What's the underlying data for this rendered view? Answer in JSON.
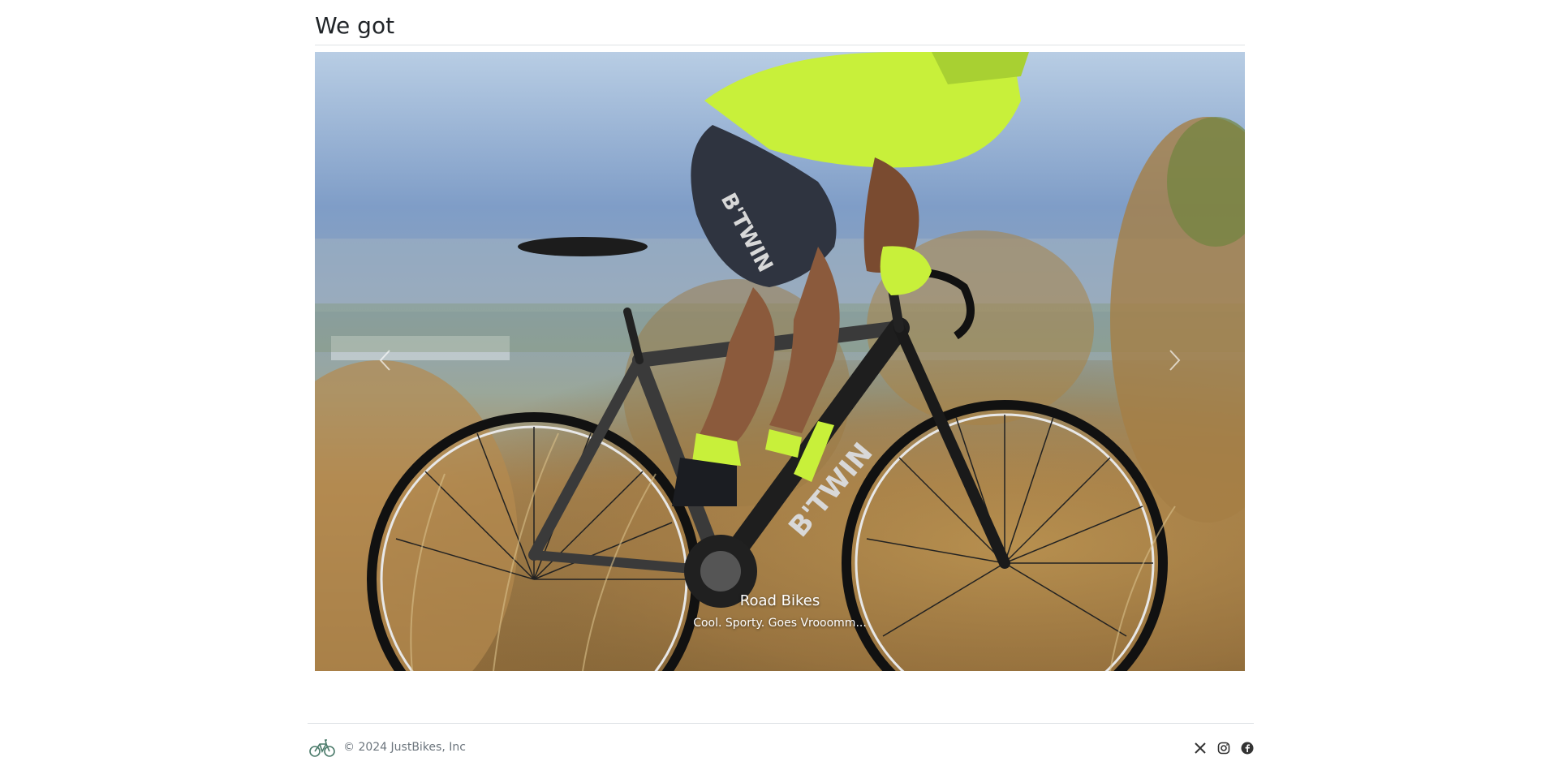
{
  "header": {
    "title": "We got"
  },
  "carousel": {
    "prev_icon": "chevron-left-icon",
    "next_icon": "chevron-right-icon",
    "active_slide": {
      "title": "Road Bikes",
      "subtitle": "Cool. Sporty. Goes Vrooomm..."
    }
  },
  "footer": {
    "logo_icon": "bicycle-icon",
    "copyright": "© 2024 JustBikes, Inc",
    "social": [
      {
        "icon": "x-twitter-icon"
      },
      {
        "icon": "instagram-icon"
      },
      {
        "icon": "facebook-icon"
      }
    ]
  },
  "colors": {
    "text": "#212529",
    "muted": "#6c757d",
    "border": "#dee2e6",
    "jersey": "#c8f03a"
  }
}
